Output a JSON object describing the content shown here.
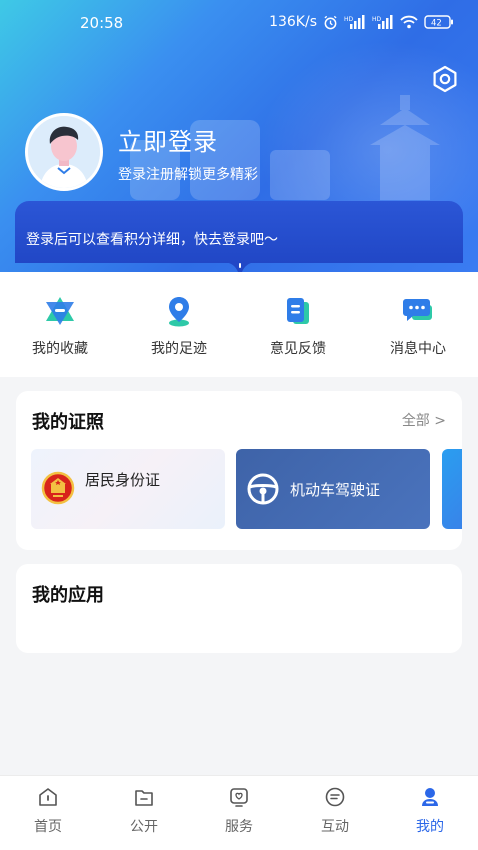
{
  "status_bar": {
    "time": "20:58",
    "network_speed": "136K/s",
    "battery": "42"
  },
  "profile": {
    "login_title": "立即登录",
    "login_subtitle": "登录注册解锁更多精彩",
    "points_hint": "登录后可以查看积分详细，快去登录吧～"
  },
  "quick_actions": [
    {
      "label": "我的收藏",
      "icon": "favorites-icon"
    },
    {
      "label": "我的足迹",
      "icon": "location-pin-icon"
    },
    {
      "label": "意见反馈",
      "icon": "feedback-document-icon"
    },
    {
      "label": "消息中心",
      "icon": "message-bubble-icon"
    }
  ],
  "licenses_section": {
    "title": "我的证照",
    "more_label": "全部 >",
    "items": [
      {
        "name": "居民身份证",
        "icon": "national-emblem-icon"
      },
      {
        "name": "机动车驾驶证",
        "icon": "steering-wheel-icon"
      }
    ]
  },
  "apps_section": {
    "title": "我的应用"
  },
  "bottom_nav": [
    {
      "label": "首页",
      "icon": "home-icon",
      "active": false
    },
    {
      "label": "公开",
      "icon": "folder-icon",
      "active": false
    },
    {
      "label": "服务",
      "icon": "service-icon",
      "active": false
    },
    {
      "label": "互动",
      "icon": "chat-icon",
      "active": false
    },
    {
      "label": "我的",
      "icon": "profile-icon",
      "active": true
    }
  ],
  "colors": {
    "accent": "#2b67e8",
    "banner": "#2147c6",
    "header_start": "#3ec9e6",
    "header_end": "#3a7cf2"
  }
}
